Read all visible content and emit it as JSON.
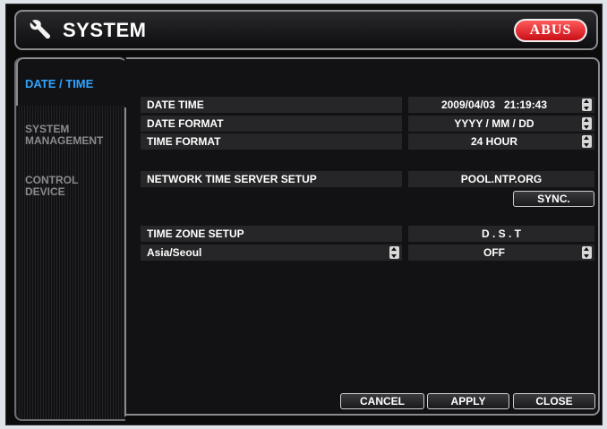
{
  "window": {
    "title": "SYSTEM",
    "logo_text": "ABUS"
  },
  "tabs": [
    {
      "label": "DATE / TIME",
      "active": true
    },
    {
      "label": "SYSTEM MANAGEMENT",
      "line1": "SYSTEM",
      "line2": "MANAGEMENT",
      "active": false
    },
    {
      "label": "CONTROL DEVICE",
      "line1": "CONTROL",
      "line2": "DEVICE",
      "active": false
    }
  ],
  "date_time": {
    "date_time_label": "DATE TIME",
    "date_time_value": "2009/04/03   21:19:43",
    "date_format_label": "DATE FORMAT",
    "date_format_value": "YYYY / MM / DD",
    "time_format_label": "TIME FORMAT",
    "time_format_value": "24 HOUR",
    "ntp_label": "NETWORK TIME SERVER SETUP",
    "ntp_value": "POOL.NTP.ORG",
    "sync_label": "SYNC.",
    "time_zone_label": "TIME ZONE SETUP",
    "dst_label": "D . S . T",
    "time_zone_value": "Asia/Seoul",
    "dst_value": "OFF"
  },
  "footer": {
    "cancel_label": "CANCEL",
    "apply_label": "APPLY",
    "close_label": "CLOSE"
  },
  "colors": {
    "accent": "#2fa4ff",
    "background": "#121214",
    "field": "#262628",
    "brand": "#d8141c"
  }
}
